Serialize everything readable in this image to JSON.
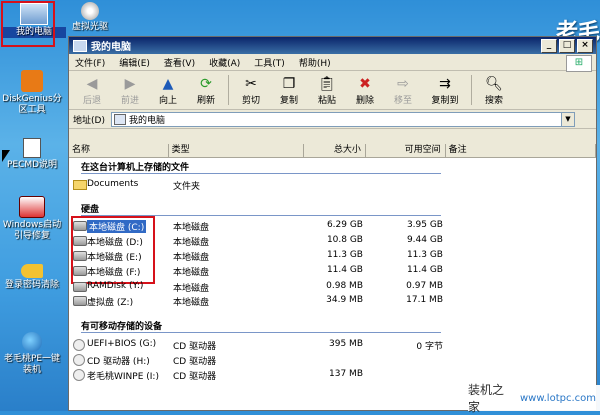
{
  "desktop": {
    "icons": [
      {
        "label": "我的电脑"
      },
      {
        "label": "DiskGenius分区工具"
      },
      {
        "label": "PECMD说明"
      },
      {
        "label": "Windows启动引导修复"
      },
      {
        "label": "登录密码清除"
      },
      {
        "label": "老毛桃PE一键装机"
      },
      {
        "label": "虚拟光驱"
      }
    ],
    "corner_logo": "老毛"
  },
  "window": {
    "title": "我的电脑",
    "menu": [
      "文件(F)",
      "编辑(E)",
      "查看(V)",
      "收藏(A)",
      "工具(T)",
      "帮助(H)"
    ],
    "toolbar": {
      "back": "后退",
      "forward": "前进",
      "up": "向上",
      "refresh": "刷新",
      "cut": "剪切",
      "copy": "复制",
      "paste": "粘贴",
      "delete": "删除",
      "move_to": "移至",
      "copy_to": "复制到",
      "search": "搜索"
    },
    "address": {
      "label": "地址(D)",
      "value": "我的电脑"
    },
    "columns": {
      "name": "名称",
      "type": "类型",
      "total": "总大小",
      "free": "可用空间",
      "note": "备注"
    },
    "groups": {
      "files": "在这台计算机上存储的文件",
      "hdd": "硬盘",
      "removable": "有可移动存储的设备"
    },
    "files": [
      {
        "name": "Documents",
        "type": "文件夹",
        "total": "",
        "free": ""
      }
    ],
    "drives": [
      {
        "name": "本地磁盘 (C:)",
        "type": "本地磁盘",
        "total": "6.29 GB",
        "free": "3.95 GB"
      },
      {
        "name": "本地磁盘 (D:)",
        "type": "本地磁盘",
        "total": "10.8 GB",
        "free": "9.44 GB"
      },
      {
        "name": "本地磁盘 (E:)",
        "type": "本地磁盘",
        "total": "11.3 GB",
        "free": "11.3 GB"
      },
      {
        "name": "本地磁盘 (F:)",
        "type": "本地磁盘",
        "total": "11.4 GB",
        "free": "11.4 GB"
      },
      {
        "name": "RAMDisk (Y:)",
        "type": "本地磁盘",
        "total": "0.98 MB",
        "free": "0.97 MB"
      },
      {
        "name": "虚拟盘 (Z:)",
        "type": "本地磁盘",
        "total": "34.9 MB",
        "free": "17.1 MB"
      }
    ],
    "removable": [
      {
        "name": "UEFI+BIOS (G:)",
        "type": "CD 驱动器",
        "total": "395 MB",
        "free": "0 字节"
      },
      {
        "name": "CD 驱动器 (H:)",
        "type": "CD 驱动器",
        "total": "",
        "free": ""
      },
      {
        "name": "老毛桃WINPE (I:)",
        "type": "CD 驱动器",
        "total": "137 MB",
        "free": ""
      }
    ]
  },
  "watermark": {
    "cn": "装机之家",
    "url": "www.lotpc.com"
  },
  "colors": {
    "selection": "#316ac5",
    "highlight_box": "#d6111a",
    "titlebar": "#0a246a"
  }
}
